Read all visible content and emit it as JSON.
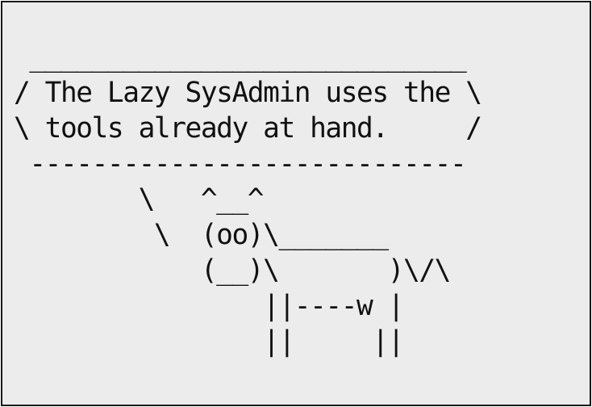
{
  "terminal": {
    "lines": [
      " ____________________________",
      "/ The Lazy SysAdmin uses the \\",
      "\\ tools already at hand.     /",
      " ----------------------------",
      "        \\   ^__^",
      "         \\  (oo)\\_______",
      "            (__)\\       )\\/\\",
      "                ||----w |",
      "                ||     ||"
    ]
  },
  "colors": {
    "background": "#ececec",
    "text": "#111111",
    "border": "#1a1a1a"
  }
}
